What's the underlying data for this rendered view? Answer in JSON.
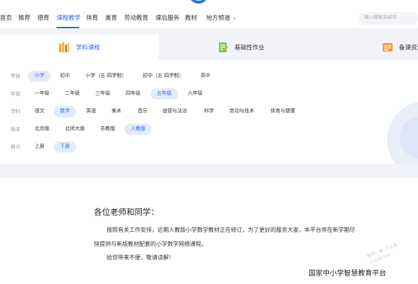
{
  "nav": {
    "items": [
      "首页",
      "推荐",
      "德育",
      "课程教学",
      "体育",
      "美育",
      "劳动教育",
      "课后服务",
      "教材",
      "地方频道"
    ],
    "active": "课程教学"
  },
  "search": {
    "placeholder": "输入搜索关键词"
  },
  "tabs": [
    {
      "label": "学科课程",
      "icon": "books-icon"
    },
    {
      "label": "基础性作业",
      "icon": "homework-icon"
    },
    {
      "label": "备课资源",
      "icon": "resource-icon"
    }
  ],
  "filters": {
    "stage": {
      "label": "学段",
      "options": [
        "小学",
        "初中",
        "小学（五·四学制）",
        "初中（五·四学制）",
        "高中"
      ],
      "selected": "小学"
    },
    "grade": {
      "label": "年级",
      "options": [
        "一年级",
        "二年级",
        "三年级",
        "四年级",
        "五年级",
        "六年级"
      ],
      "selected": "五年级"
    },
    "subject": {
      "label": "学科",
      "options": [
        "语文",
        "数学",
        "英语",
        "美术",
        "音乐",
        "道德与法治",
        "科学",
        "劳动与技术",
        "体育与健康"
      ],
      "selected": "数学"
    },
    "edition": {
      "label": "版本",
      "options": [
        "北京版",
        "北师大版",
        "苏教版",
        "人教版"
      ],
      "selected": "人教版"
    },
    "volume": {
      "label": "册次",
      "options": [
        "上册",
        "下册"
      ],
      "selected": "下册"
    }
  },
  "notice": {
    "greeting": "各位老师和同学：",
    "line1": "按照有关工作安排，近期人教版小学数学教材正在修订，为了更好的服务大家，本平台将在新学期尽",
    "line2": "快提供与新版教材配套的小学数学网络课程。",
    "line3": "给您带来不便，敬请谅解！",
    "signature": "国家中小学智慧教育平台"
  },
  "watermark": {
    "line1": "值得一看··什么值",
    "line2": "smzdm.com"
  },
  "colors": {
    "accent": "#2f6fe6",
    "chip_selected_bg": "#e3ebfb",
    "band_bg": "#f1f3f8"
  }
}
